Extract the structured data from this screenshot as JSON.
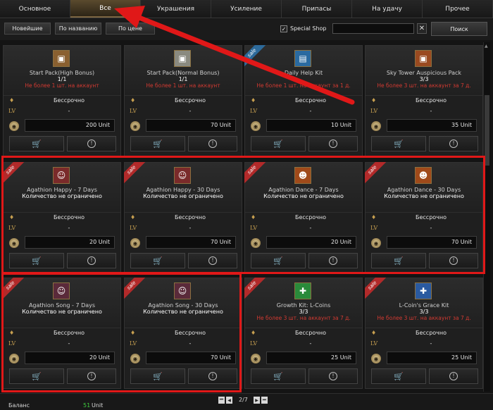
{
  "tabs": [
    {
      "label": "Основное",
      "active": false
    },
    {
      "label": "Все",
      "active": true
    },
    {
      "label": "Украшения",
      "active": false
    },
    {
      "label": "Усиление",
      "active": false
    },
    {
      "label": "Припасы",
      "active": false
    },
    {
      "label": "На удачу",
      "active": false
    },
    {
      "label": "Прочее",
      "active": false
    }
  ],
  "sort": {
    "newest": "Новейшие",
    "by_name": "По названию",
    "by_price": "По цене",
    "special_shop_label": "Special Shop",
    "special_shop_checked": true,
    "search_value": "",
    "clear_symbol": "✕",
    "search_button": "Поиск"
  },
  "common": {
    "duration": "Бессрочно",
    "level": "-",
    "lv_label": "LV"
  },
  "cards": [
    {
      "name": "Start Pack(High Bonus)",
      "qty": "1/1",
      "limit": "Не более 1 шт. на аккаунт",
      "price": "200 Unit",
      "ribbon": "",
      "icon": "chest-icon",
      "glyph": "▣",
      "iconcolor": "#8a6030"
    },
    {
      "name": "Start Pack(Normal Bonus)",
      "qty": "1/1",
      "limit": "Не более 1 шт. на аккаунт",
      "price": "70 Unit",
      "ribbon": "",
      "icon": "chest-icon",
      "glyph": "▣",
      "iconcolor": "#8a8a80"
    },
    {
      "name": "Daily Help Kit",
      "qty": "",
      "limit": "Не более 1 шт. на аккаунт за 1 д.",
      "price": "10 Unit",
      "ribbon": "blue",
      "icon": "kit-box-icon",
      "glyph": "▤",
      "iconcolor": "#2a6aa0"
    },
    {
      "name": "Sky Tower Auspicious Pack",
      "qty": "3/3",
      "limit": "Не более 3 шт. на аккаунт за 7 д.",
      "price": "35 Unit",
      "ribbon": "",
      "icon": "chest-icon",
      "glyph": "▣",
      "iconcolor": "#9a4a20"
    },
    {
      "name": "Agathion Happy - 7 Days",
      "qty": "Количество не ограничено",
      "limit": "",
      "price": "20 Unit",
      "ribbon": "sale",
      "icon": "agathion-icon",
      "glyph": "☺",
      "iconcolor": "#7a2a2a"
    },
    {
      "name": "Agathion Happy - 30 Days",
      "qty": "Количество не ограничено",
      "limit": "",
      "price": "70 Unit",
      "ribbon": "sale",
      "icon": "agathion-icon",
      "glyph": "☺",
      "iconcolor": "#7a2a2a"
    },
    {
      "name": "Agathion Dance - 7 Days",
      "qty": "Количество не ограничено",
      "limit": "",
      "price": "20 Unit",
      "ribbon": "sale",
      "icon": "agathion-icon",
      "glyph": "☻",
      "iconcolor": "#a04a1a"
    },
    {
      "name": "Agathion Dance - 30 Days",
      "qty": "Количество не ограничено",
      "limit": "",
      "price": "70 Unit",
      "ribbon": "sale",
      "icon": "agathion-icon",
      "glyph": "☻",
      "iconcolor": "#a04a1a"
    },
    {
      "name": "Agathion Song - 7 Days",
      "qty": "Количество не ограничено",
      "limit": "",
      "price": "20 Unit",
      "ribbon": "sale",
      "icon": "agathion-icon",
      "glyph": "☺",
      "iconcolor": "#5a2a3a"
    },
    {
      "name": "Agathion Song - 30 Days",
      "qty": "Количество не ограничено",
      "limit": "",
      "price": "70 Unit",
      "ribbon": "sale",
      "icon": "agathion-icon",
      "glyph": "☺",
      "iconcolor": "#5a2a3a"
    },
    {
      "name": "Growth Kit: L-Coins",
      "qty": "3/3",
      "limit": "Не более 3 шт. на аккаунт за 7 д.",
      "price": "25 Unit",
      "ribbon": "sale",
      "icon": "gift-box-icon",
      "glyph": "✚",
      "iconcolor": "#2a8a3a"
    },
    {
      "name": "L-Coin's Grace Kit",
      "qty": "3/3",
      "limit": "Не более 3 шт. на аккаунт за 7 д.",
      "price": "25 Unit",
      "ribbon": "sale",
      "icon": "gift-box-icon",
      "glyph": "✚",
      "iconcolor": "#2a5aa0"
    }
  ],
  "footer": {
    "balance_label": "Баланс",
    "balance_value": "51",
    "balance_unit": "Unit",
    "page": "2/7"
  }
}
